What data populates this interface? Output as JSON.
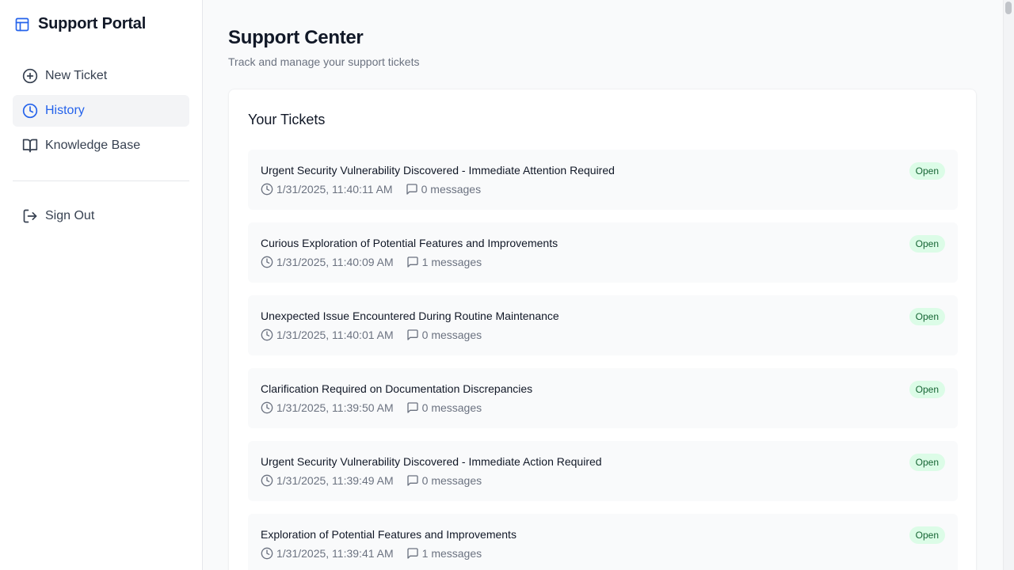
{
  "brand": {
    "title": "Support Portal"
  },
  "sidebar": {
    "items": [
      {
        "label": "New Ticket",
        "icon": "plus-circle-icon"
      },
      {
        "label": "History",
        "icon": "clock-icon",
        "active": true
      },
      {
        "label": "Knowledge Base",
        "icon": "book-open-icon"
      }
    ],
    "signout_label": "Sign Out"
  },
  "header": {
    "title": "Support Center",
    "subtitle": "Track and manage your support tickets"
  },
  "tickets": {
    "section_title": "Your Tickets",
    "items": [
      {
        "title": "Urgent Security Vulnerability Discovered - Immediate Attention Required",
        "timestamp": "1/31/2025, 11:40:11 AM",
        "messages": "0 messages",
        "status": "Open"
      },
      {
        "title": "Curious Exploration of Potential Features and Improvements",
        "timestamp": "1/31/2025, 11:40:09 AM",
        "messages": "1 messages",
        "status": "Open"
      },
      {
        "title": "Unexpected Issue Encountered During Routine Maintenance",
        "timestamp": "1/31/2025, 11:40:01 AM",
        "messages": "0 messages",
        "status": "Open"
      },
      {
        "title": "Clarification Required on Documentation Discrepancies",
        "timestamp": "1/31/2025, 11:39:50 AM",
        "messages": "0 messages",
        "status": "Open"
      },
      {
        "title": "Urgent Security Vulnerability Discovered - Immediate Action Required",
        "timestamp": "1/31/2025, 11:39:49 AM",
        "messages": "0 messages",
        "status": "Open"
      },
      {
        "title": "Exploration of Potential Features and Improvements",
        "timestamp": "1/31/2025, 11:39:41 AM",
        "messages": "1 messages",
        "status": "Open"
      }
    ]
  },
  "colors": {
    "accent": "#2563eb",
    "badge_bg": "#dcfce7",
    "badge_text": "#166534"
  }
}
